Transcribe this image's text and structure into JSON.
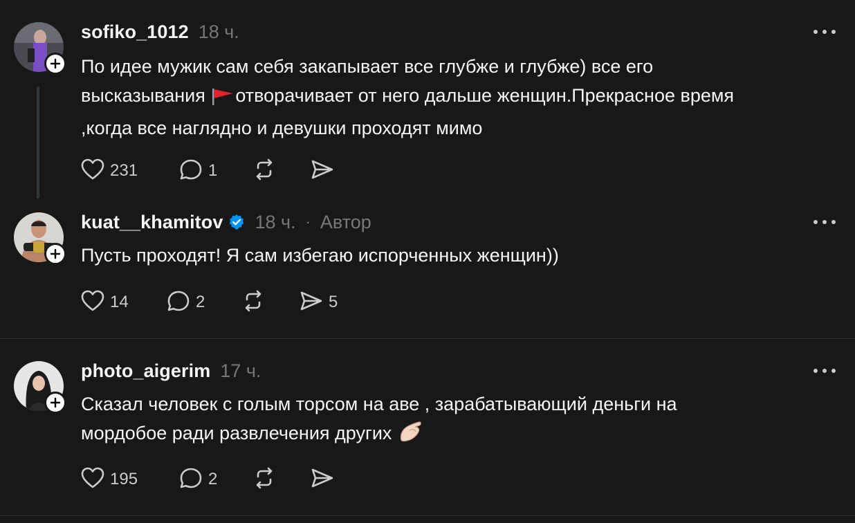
{
  "posts": [
    {
      "username": "sofiko_1012",
      "time": "18 ч.",
      "text_before": "По идее мужик сам себя закапывает все глубже и глубже) все его\nвысказывания ",
      "text_emoji": "red-flag",
      "text_after": "отворачивает от него дальше женщин.Прекрасное время\n,когда все наглядно и девушки проходят мимо",
      "likes": "231",
      "replies": "1",
      "reposts": "",
      "shares": ""
    },
    {
      "username": "kuat__khamitov",
      "verified": true,
      "time": "18 ч.",
      "separator": "·",
      "role": "Автор",
      "text": "Пусть проходят! Я сам избегаю испорченных женщин))",
      "likes": "14",
      "replies": "2",
      "reposts": "",
      "shares": "5"
    },
    {
      "username": "photo_aigerim",
      "time": "17 ч.",
      "text_before": "Сказал человек с голым торсом на аве , зарабатывающий деньги на\nмордобое ради развлечения других ",
      "text_emoji": "pinched-fingers",
      "likes": "195",
      "replies": "2",
      "reposts": "",
      "shares": ""
    }
  ],
  "colors": {
    "background": "#181818",
    "text": "#f3f5f7",
    "muted": "#777777",
    "verified": "#0095f6"
  }
}
